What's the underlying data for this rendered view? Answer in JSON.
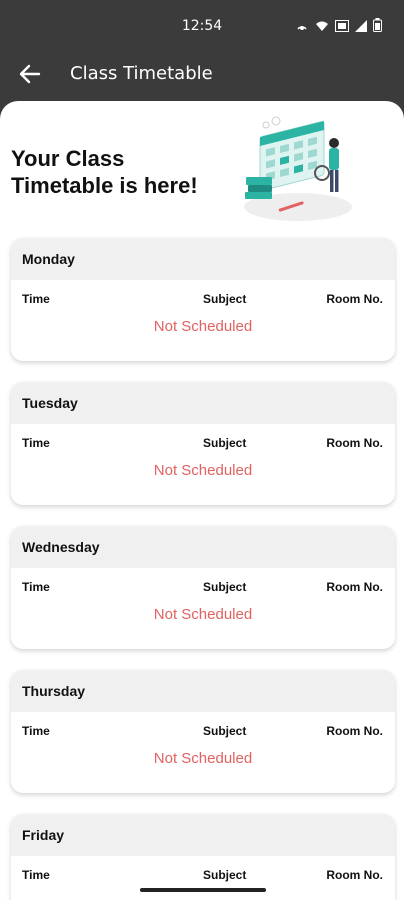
{
  "status_bar": {
    "time": "12:54",
    "icons": [
      "hotspot-icon",
      "wifi-icon",
      "data-icon",
      "signal-icon",
      "battery-icon"
    ]
  },
  "app_bar": {
    "title": "Class Timetable",
    "back_icon": "arrow-left-icon"
  },
  "hero": {
    "line1": "Your Class",
    "line2": "Timetable is here!"
  },
  "columns": {
    "time": "Time",
    "subject": "Subject",
    "room": "Room No."
  },
  "days": [
    {
      "name": "Monday",
      "status": "Not Scheduled"
    },
    {
      "name": "Tuesday",
      "status": "Not Scheduled"
    },
    {
      "name": "Wednesday",
      "status": "Not Scheduled"
    },
    {
      "name": "Thursday",
      "status": "Not Scheduled"
    },
    {
      "name": "Friday",
      "status": ""
    }
  ],
  "colors": {
    "app_bar": "#3b3b3b",
    "not_scheduled": "#e26262",
    "header_bg": "#f0f0f0",
    "accent": "#2bb3a3"
  }
}
